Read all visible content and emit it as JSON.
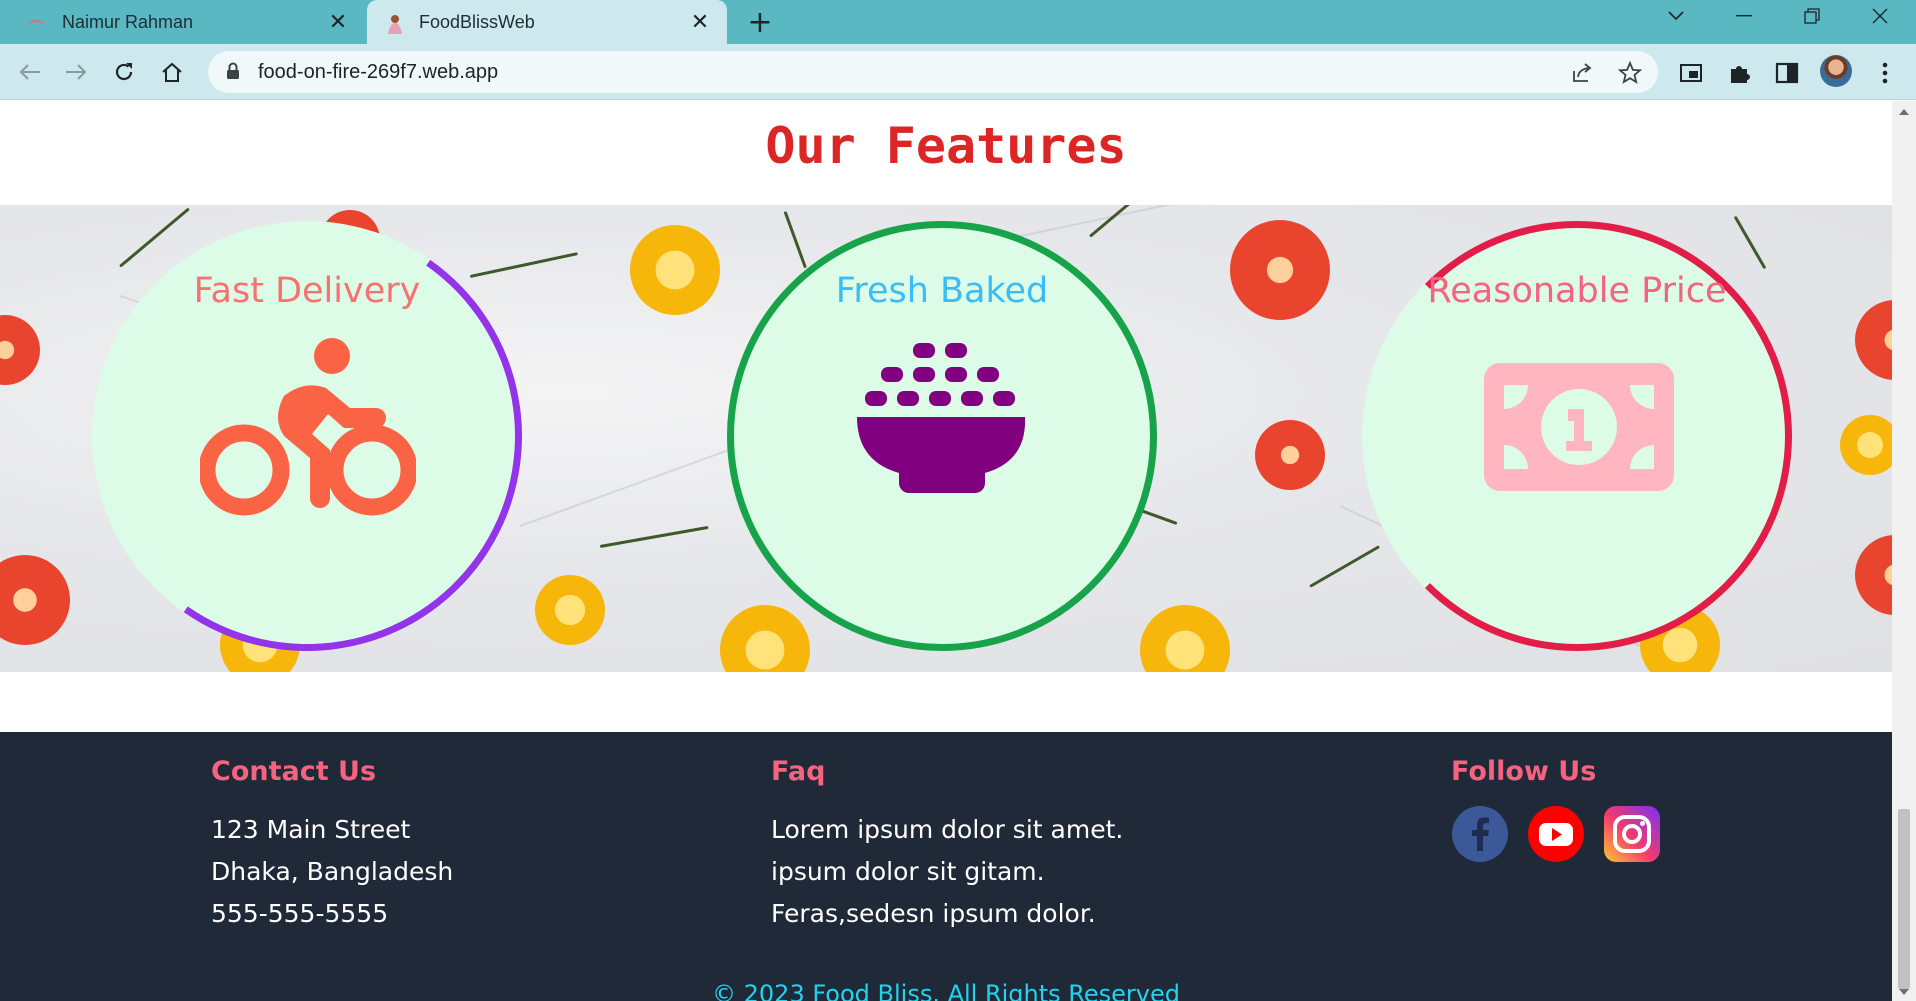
{
  "browser": {
    "tabs": [
      {
        "title": "Naimur Rahman",
        "active": false
      },
      {
        "title": "FoodBlissWeb",
        "active": true
      }
    ],
    "url": "food-on-fire-269f7.web.app"
  },
  "features": {
    "heading": "Our Features",
    "cards": [
      {
        "title": "Fast Delivery",
        "icon": "bicycle-icon",
        "title_color": "#f87171",
        "ring_color": "#9333ea",
        "icon_color": "#fb6345"
      },
      {
        "title": "Fresh Baked",
        "icon": "bowl-icon",
        "title_color": "#38bdf8",
        "ring_color": "#16a34a",
        "icon_color": "#800080"
      },
      {
        "title": "Reasonable Price",
        "icon": "money-bill-icon",
        "title_color": "#f56380",
        "ring_color": "#e11d48",
        "icon_color": "#ffb6c1"
      }
    ]
  },
  "footer": {
    "contact": {
      "heading": "Contact Us",
      "lines": [
        "123 Main Street",
        "Dhaka, Bangladesh",
        "555-555-5555"
      ]
    },
    "faq": {
      "heading": "Faq",
      "lines": [
        "Lorem ipsum dolor sit amet.",
        "ipsum dolor sit gitam.",
        "Feras,sedesn ipsum dolor."
      ]
    },
    "follow": {
      "heading": "Follow Us",
      "icons": [
        "facebook-icon",
        "youtube-icon",
        "instagram-icon"
      ]
    },
    "copyright": "© 2023 Food Bliss. All Rights Reserved"
  },
  "colors": {
    "heading_red": "#dc2626",
    "footer_bg": "#1f2937",
    "footer_heading": "#f56380",
    "copyright": "#22d3ee",
    "card_bg": "#dcfce7"
  }
}
